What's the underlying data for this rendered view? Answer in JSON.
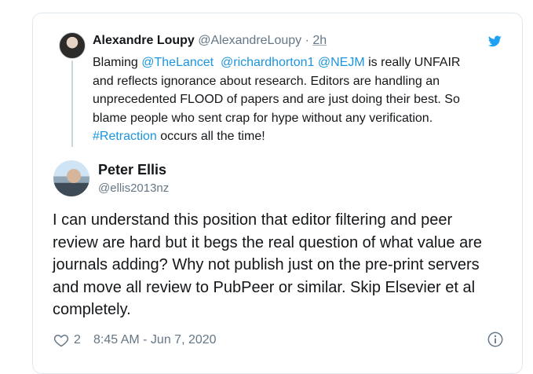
{
  "quoted": {
    "name": "Alexandre Loupy",
    "handle": "@AlexandreLoupy",
    "separator": "·",
    "time": "2h",
    "lines": [
      [
        "Blaming ",
        "@TheLancet",
        "  ",
        "@richardhorton1",
        " ",
        "@NEJM",
        " is really UNFAIR"
      ],
      "and reflects ignorance about research. Editors are handling an",
      "unprecedented FLOOD of papers and are just doing their best. So",
      "blame people who sent crap for hype without any verification.",
      [
        "#Retraction",
        " occurs all the time!"
      ]
    ]
  },
  "tweet": {
    "name": "Peter Ellis",
    "handle": "@ellis2013nz",
    "lines": [
      "I can understand this position that editor filtering and peer",
      "review are hard but it begs the real question of what value are",
      "journals adding? Why not publish just on the pre-print servers",
      "and move all review to PubPeer or similar. Skip Elsevier et al",
      "completely."
    ],
    "likes": "2",
    "timestamp": "8:45 AM - Jun 7, 2020"
  },
  "colors": {
    "link": "#1b95e0",
    "secondary_text": "#657786",
    "twitter_blue": "#1da1f2"
  },
  "icons": {
    "brand": "twitter-bird-icon",
    "like": "heart-icon",
    "info": "info-icon"
  }
}
